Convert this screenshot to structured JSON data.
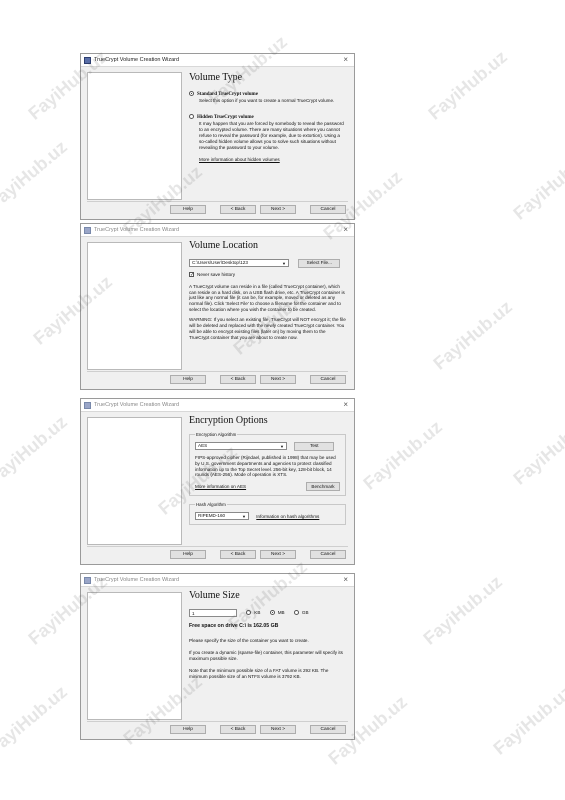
{
  "watermark": "FayiHub.uz",
  "common": {
    "window_title": "TrueCrypt Volume Creation Wizard",
    "close_glyph": "×",
    "help": "Help",
    "back": "< Back",
    "next": "Next >",
    "cancel": "Cancel"
  },
  "volume_type": {
    "heading": "Volume Type",
    "standard_label": "Standard TrueCrypt volume",
    "standard_desc": "Select this option if you want to create a normal TrueCrypt volume.",
    "hidden_label": "Hidden TrueCrypt volume",
    "hidden_desc": "It may happen that you are forced by somebody to reveal the password to an encrypted volume. There are many situations where you cannot refuse to reveal the password (for example, due to extortion). Using a so-called hidden volume allows you to solve such situations without revealing the password to your volume.",
    "more_info": "More information about hidden volumes"
  },
  "volume_location": {
    "heading": "Volume Location",
    "path": "C:\\Users\\User\\Desktop\\123",
    "select_file": "Select File...",
    "never_save": "Never save history",
    "desc1": "A TrueCrypt volume can reside in a file (called TrueCrypt container), which can reside on a hard disk, on a USB flash drive, etc. A TrueCrypt container is just like any normal file (it can be, for example, moved or deleted as any normal file). Click 'Select File' to choose a filename for the container and to select the location where you wish the container to be created.",
    "desc2": "WARNING: If you select an existing file, TrueCrypt will NOT encrypt it; the file will be deleted and replaced with the newly created TrueCrypt container. You will be able to encrypt existing files (later on) by moving them to the TrueCrypt container that you are about to create now."
  },
  "encryption_options": {
    "heading": "Encryption Options",
    "algo_legend": "Encryption Algorithm",
    "algo_value": "AES",
    "test": "Test",
    "algo_desc": "FIPS-approved cipher (Rijndael, published in 1998) that may be used by U.S. government departments and agencies to protect classified information up to the Top Secret level. 256-bit key, 128-bit block, 14 rounds (AES-256). Mode of operation is XTS.",
    "more_aes": "More information on AES",
    "benchmark": "Benchmark",
    "hash_legend": "Hash Algorithm",
    "hash_value": "RIPEMD-160",
    "hash_info": "Information on hash algorithms"
  },
  "volume_size": {
    "heading": "Volume Size",
    "size_value": "1",
    "kb": "KB",
    "mb": "MB",
    "gb": "GB",
    "free_space": "Free space on drive C:\\ is 162.05 GB",
    "p1": "Please specify the size of the container you want to create.",
    "p2": "If you create a dynamic (sparse-file) container, this parameter will specify its maximum possible size.",
    "p3": "Note that the minimum possible size of a FAT volume is 292 KB. The minimum possible size of an NTFS volume is 3792 KB."
  }
}
